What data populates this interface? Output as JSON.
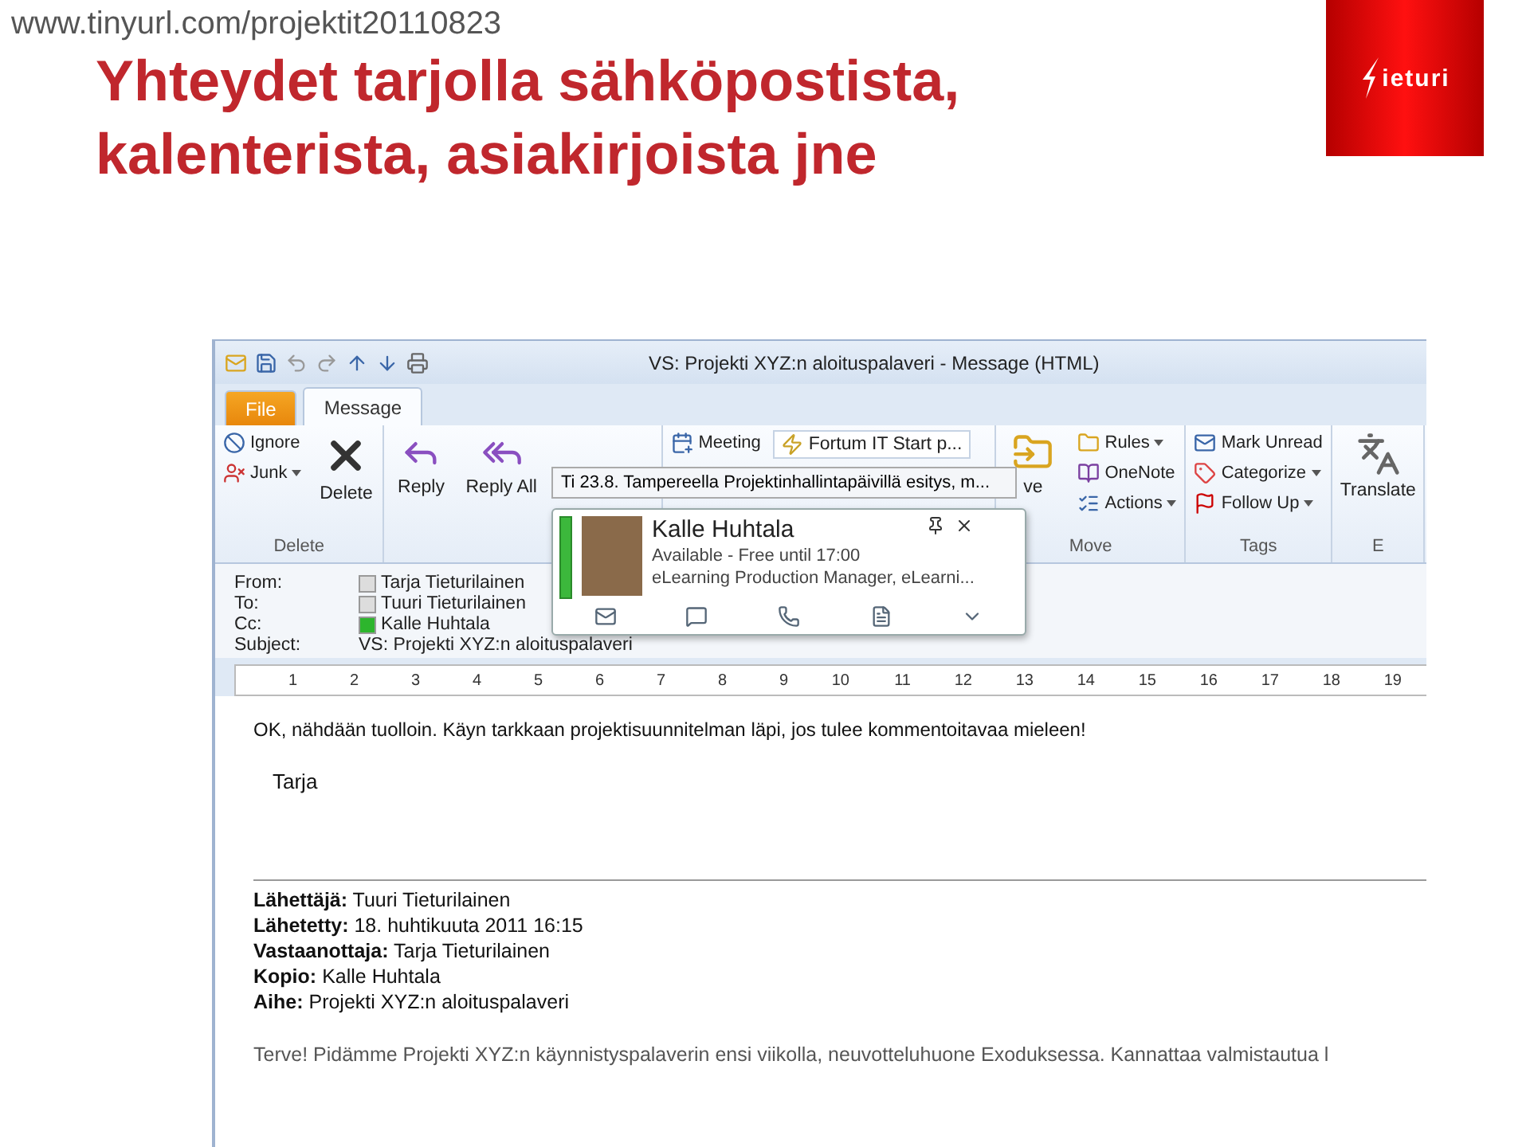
{
  "url": "www.tinyurl.com/projektit20110823",
  "title_lines": [
    "Yhteydet tarjolla sähköpostista,",
    "kalenterista, asiakirjoista jne"
  ],
  "logo": {
    "text": "ieturi"
  },
  "window": {
    "title": "VS: Projekti XYZ:n aloituspalaveri  -  Message (HTML)"
  },
  "ribbon_tabs": [
    {
      "label": "File",
      "kind": "file",
      "selected": false
    },
    {
      "label": "Message",
      "kind": "tab",
      "selected": true
    }
  ],
  "ribbon_groups": [
    {
      "label": "Delete",
      "columns": [
        [
          {
            "label": "Ignore",
            "kind": "small"
          },
          {
            "label": "Junk",
            "kind": "small",
            "dropdown": true
          }
        ],
        [
          {
            "label": "Delete",
            "kind": "large"
          }
        ]
      ]
    },
    {
      "columns": [
        [
          {
            "label": "Reply",
            "kind": "large"
          }
        ],
        [
          {
            "label": "Reply All",
            "kind": "large"
          }
        ]
      ]
    },
    {
      "columns": [
        [
          {
            "label": "Meeting",
            "kind": "small"
          }
        ],
        [
          {
            "label": "Fortum IT Start p...",
            "kind": "gallery"
          }
        ]
      ]
    },
    {
      "label": "Move",
      "columns": [
        [
          {
            "label": "ve",
            "kind": "large"
          }
        ],
        [
          {
            "label": "Rules",
            "kind": "small",
            "dropdown": true
          },
          {
            "label": "OneNote",
            "kind": "small"
          },
          {
            "label": "Actions",
            "kind": "small",
            "dropdown": true
          }
        ]
      ]
    },
    {
      "label": "Tags",
      "columns": [
        [
          {
            "label": "Mark Unread",
            "kind": "small"
          },
          {
            "label": "Categorize",
            "kind": "small",
            "dropdown": true
          },
          {
            "label": "Follow Up",
            "kind": "small",
            "dropdown": true
          }
        ]
      ]
    },
    {
      "label": "E",
      "columns": [
        [
          {
            "label": "Translate",
            "kind": "large"
          }
        ]
      ]
    }
  ],
  "contact_card": {
    "tooltip": "Ti 23.8. Tampereella Projektinhallintapäivillä esitys, m...",
    "name": "Kalle Huhtala",
    "status": "Available - Free until 17:00",
    "title": "eLearning Production Manager, eLearni..."
  },
  "header_fields": [
    {
      "label": "From:",
      "value": "Tarja Tieturilainen",
      "kind": "person",
      "available": false
    },
    {
      "label": "To:",
      "value": "Tuuri Tieturilainen",
      "kind": "person",
      "available": false
    },
    {
      "label": "Cc:",
      "value": "Kalle Huhtala",
      "kind": "person",
      "available": true
    },
    {
      "label": "Subject:",
      "value": "VS: Projekti XYZ:n aloituspalaveri",
      "kind": "text"
    }
  ],
  "ruler": [
    "1",
    "2",
    "3",
    "4",
    "5",
    "6",
    "7",
    "8",
    "9",
    "10",
    "11",
    "12",
    "13",
    "14",
    "15",
    "16",
    "17",
    "18",
    "19"
  ],
  "body": {
    "message": "OK, nähdään tuolloin. Käyn tarkkaan projektisuunnitelman läpi, jos tulee kommentoitavaa mieleen!",
    "signature": "Tarja",
    "quoted_header": [
      {
        "label": "Lähettäjä:",
        "value": "Tuuri Tieturilainen"
      },
      {
        "label": "Lähetetty:",
        "value": "18. huhtikuuta 2011 16:15"
      },
      {
        "label": "Vastaanottaja:",
        "value": "Tarja Tieturilainen"
      },
      {
        "label": "Kopio:",
        "value": "Kalle Huhtala"
      },
      {
        "label": "Aihe:",
        "value": "Projekti XYZ:n aloituspalaveri"
      }
    ],
    "quoted_text": "Terve! Pidämme Projekti XYZ:n käynnistyspalaverin ensi viikolla, neuvotteluhuone Exoduksessa. Kannattaa valmistautua l"
  }
}
